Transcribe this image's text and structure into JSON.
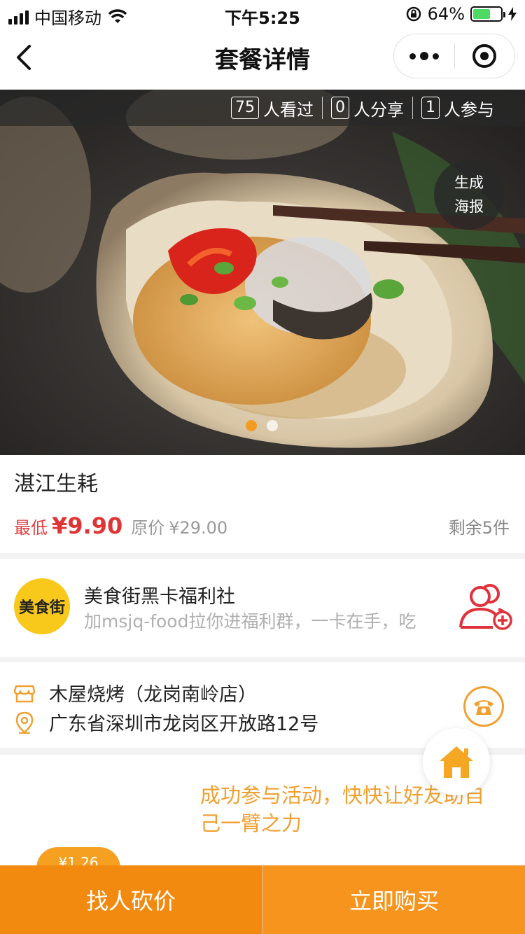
{
  "status_bar": {
    "carrier": "中国移动",
    "time": "下午5:25",
    "battery_percent": "64%",
    "battery_level": 0.64
  },
  "nav": {
    "title": "套餐详情"
  },
  "stats": [
    {
      "count": "75",
      "label": "人看过"
    },
    {
      "count": "0",
      "label": "人分享"
    },
    {
      "count": "1",
      "label": "人参与"
    }
  ],
  "poster": {
    "line1": "生成",
    "line2": "海报"
  },
  "carousel": {
    "total": 2,
    "active": 1
  },
  "product": {
    "title": "湛江生耗",
    "price_label": "最低",
    "price": "¥9.90",
    "original_label": "原价",
    "original_price": "¥29.00",
    "remaining": "剩余5件"
  },
  "group": {
    "logo_text": "美食街",
    "name": "美食街黑卡福利社",
    "description": "加msjq-food拉你进福利群，一卡在手，吃"
  },
  "store": {
    "name": "木屋烧烤（龙岗南岭店）",
    "address": "广东省深圳市龙岗区开放路12号"
  },
  "activity": {
    "message": "成功参与活动，快快让好友助自己一臂之力",
    "bubble_amount": "¥1.26"
  },
  "actions": {
    "bargain_label": "找人砍价",
    "buy_label": "立即购买"
  },
  "colors": {
    "accent": "#f7941d",
    "price_red": "#e03434",
    "icon_red": "#e0323c"
  }
}
